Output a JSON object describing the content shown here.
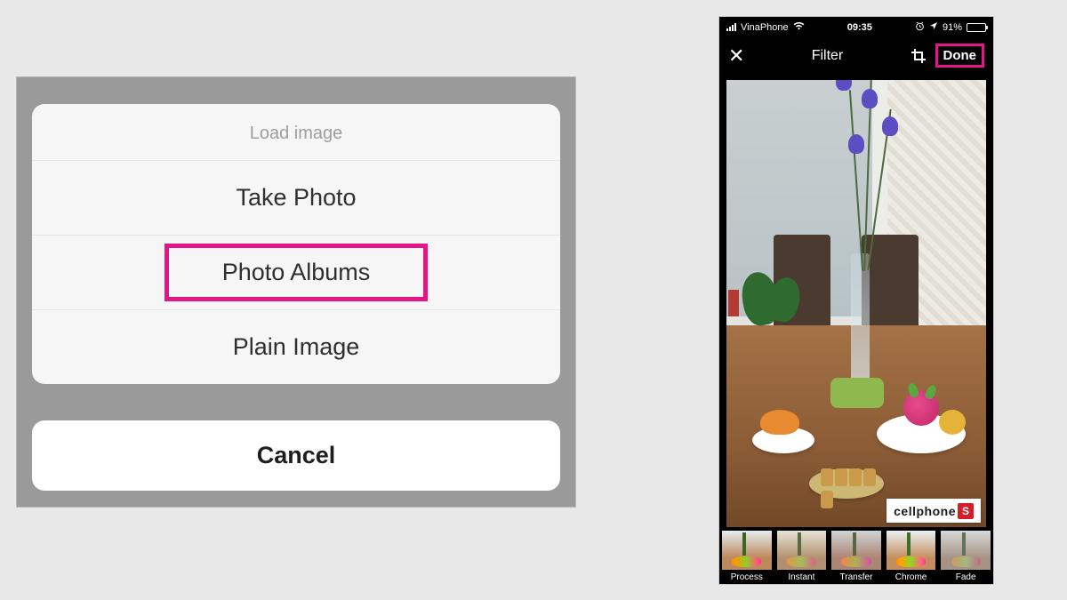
{
  "left": {
    "sheet_title": "Load image",
    "items": [
      {
        "label": "Take Photo",
        "highlighted": false
      },
      {
        "label": "Photo Albums",
        "highlighted": true
      },
      {
        "label": "Plain Image",
        "highlighted": false
      }
    ],
    "cancel": "Cancel"
  },
  "right": {
    "status": {
      "carrier": "VinaPhone",
      "time": "09:35",
      "battery_pct": "91%"
    },
    "nav": {
      "title": "Filter",
      "done": "Done"
    },
    "filters": [
      {
        "label": "Process"
      },
      {
        "label": "Instant"
      },
      {
        "label": "Transfer"
      },
      {
        "label": "Chrome"
      },
      {
        "label": "Fade"
      }
    ],
    "watermark": {
      "text": "cellphone",
      "badge": "S"
    }
  },
  "highlight_color": "#e31587"
}
